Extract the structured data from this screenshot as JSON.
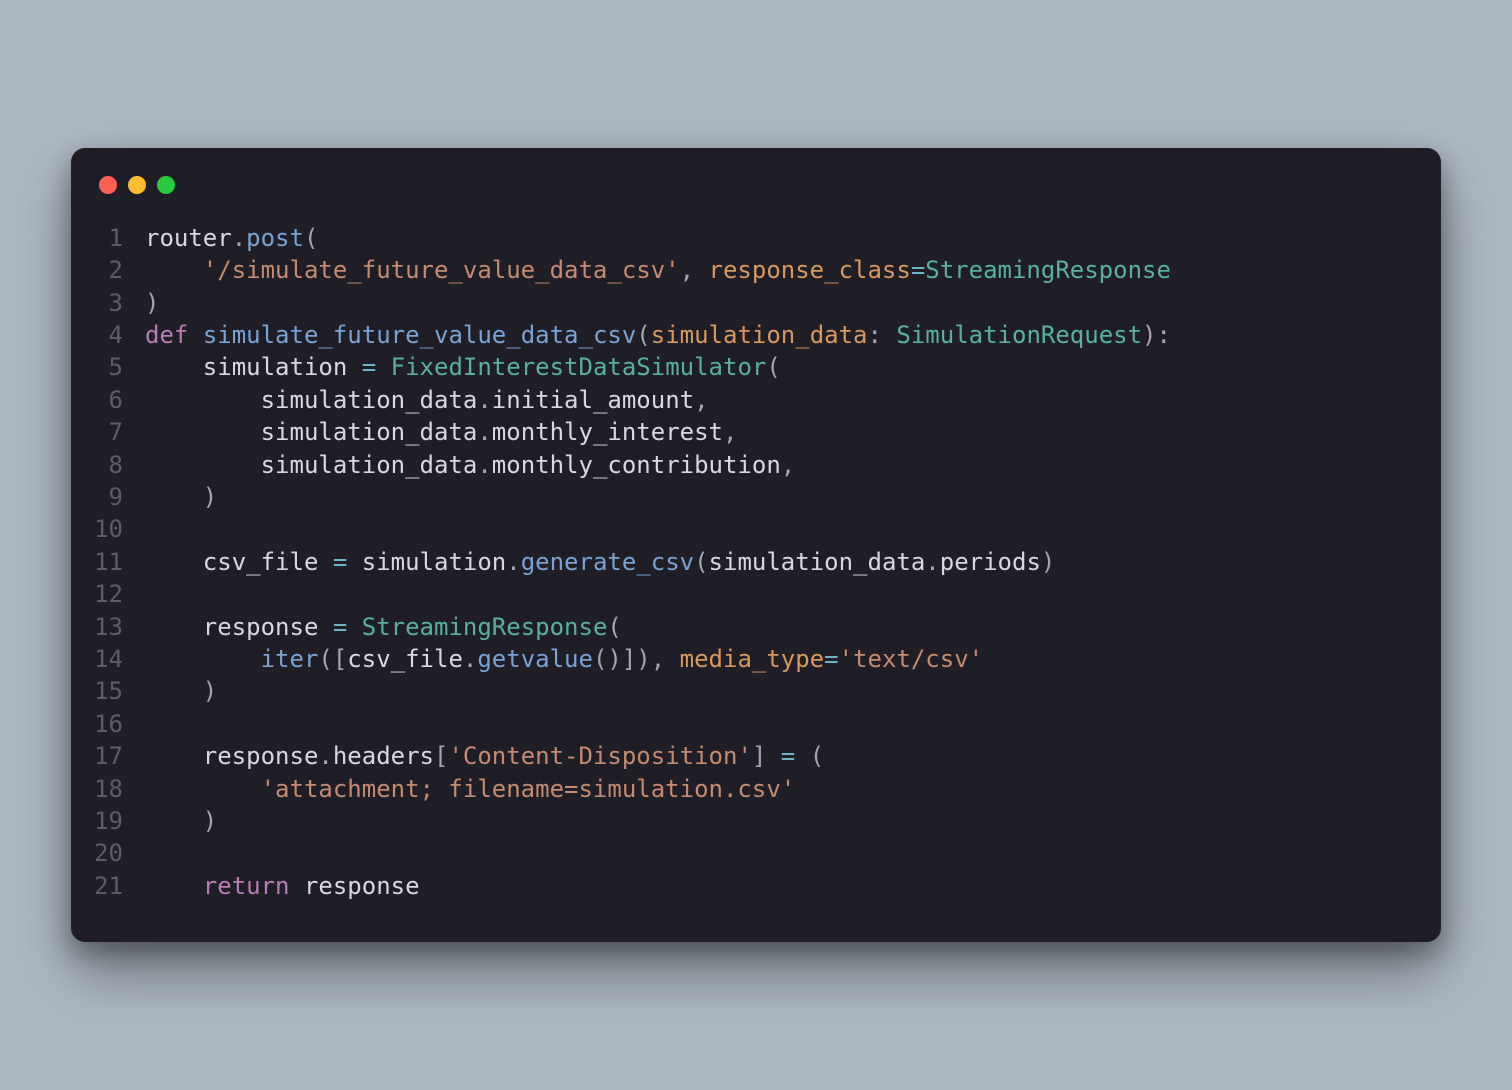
{
  "window": {
    "traffic_lights": [
      "red",
      "yellow",
      "green"
    ]
  },
  "code": {
    "line_numbers": [
      "1",
      "2",
      "3",
      "4",
      "5",
      "6",
      "7",
      "8",
      "9",
      "10",
      "11",
      "12",
      "13",
      "14",
      "15",
      "16",
      "17",
      "18",
      "19",
      "20",
      "21"
    ],
    "lines": [
      [
        {
          "cls": "t-ident",
          "text": "router"
        },
        {
          "cls": "t-punct",
          "text": "."
        },
        {
          "cls": "t-func",
          "text": "post"
        },
        {
          "cls": "t-punct",
          "text": "("
        }
      ],
      [
        {
          "cls": "t-default",
          "text": "    "
        },
        {
          "cls": "t-string",
          "text": "'/simulate_future_value_data_csv'"
        },
        {
          "cls": "t-punct",
          "text": ", "
        },
        {
          "cls": "t-param",
          "text": "response_class"
        },
        {
          "cls": "t-op",
          "text": "="
        },
        {
          "cls": "t-class",
          "text": "StreamingResponse"
        }
      ],
      [
        {
          "cls": "t-punct",
          "text": ")"
        }
      ],
      [
        {
          "cls": "t-keyword",
          "text": "def"
        },
        {
          "cls": "t-default",
          "text": " "
        },
        {
          "cls": "t-func",
          "text": "simulate_future_value_data_csv"
        },
        {
          "cls": "t-punct",
          "text": "("
        },
        {
          "cls": "t-param",
          "text": "simulation_data"
        },
        {
          "cls": "t-punct",
          "text": ": "
        },
        {
          "cls": "t-class",
          "text": "SimulationRequest"
        },
        {
          "cls": "t-punct",
          "text": "):"
        }
      ],
      [
        {
          "cls": "t-default",
          "text": "    "
        },
        {
          "cls": "t-ident",
          "text": "simulation"
        },
        {
          "cls": "t-default",
          "text": " "
        },
        {
          "cls": "t-op",
          "text": "="
        },
        {
          "cls": "t-default",
          "text": " "
        },
        {
          "cls": "t-class",
          "text": "FixedInterestDataSimulator"
        },
        {
          "cls": "t-punct",
          "text": "("
        }
      ],
      [
        {
          "cls": "t-default",
          "text": "        "
        },
        {
          "cls": "t-ident",
          "text": "simulation_data"
        },
        {
          "cls": "t-punct",
          "text": "."
        },
        {
          "cls": "t-attr",
          "text": "initial_amount"
        },
        {
          "cls": "t-punct",
          "text": ","
        }
      ],
      [
        {
          "cls": "t-default",
          "text": "        "
        },
        {
          "cls": "t-ident",
          "text": "simulation_data"
        },
        {
          "cls": "t-punct",
          "text": "."
        },
        {
          "cls": "t-attr",
          "text": "monthly_interest"
        },
        {
          "cls": "t-punct",
          "text": ","
        }
      ],
      [
        {
          "cls": "t-default",
          "text": "        "
        },
        {
          "cls": "t-ident",
          "text": "simulation_data"
        },
        {
          "cls": "t-punct",
          "text": "."
        },
        {
          "cls": "t-attr",
          "text": "monthly_contribution"
        },
        {
          "cls": "t-punct",
          "text": ","
        }
      ],
      [
        {
          "cls": "t-default",
          "text": "    "
        },
        {
          "cls": "t-punct",
          "text": ")"
        }
      ],
      [
        {
          "cls": "t-default",
          "text": ""
        }
      ],
      [
        {
          "cls": "t-default",
          "text": "    "
        },
        {
          "cls": "t-ident",
          "text": "csv_file"
        },
        {
          "cls": "t-default",
          "text": " "
        },
        {
          "cls": "t-op",
          "text": "="
        },
        {
          "cls": "t-default",
          "text": " "
        },
        {
          "cls": "t-ident",
          "text": "simulation"
        },
        {
          "cls": "t-punct",
          "text": "."
        },
        {
          "cls": "t-func",
          "text": "generate_csv"
        },
        {
          "cls": "t-punct",
          "text": "("
        },
        {
          "cls": "t-ident",
          "text": "simulation_data"
        },
        {
          "cls": "t-punct",
          "text": "."
        },
        {
          "cls": "t-attr",
          "text": "periods"
        },
        {
          "cls": "t-punct",
          "text": ")"
        }
      ],
      [
        {
          "cls": "t-default",
          "text": ""
        }
      ],
      [
        {
          "cls": "t-default",
          "text": "    "
        },
        {
          "cls": "t-ident",
          "text": "response"
        },
        {
          "cls": "t-default",
          "text": " "
        },
        {
          "cls": "t-op",
          "text": "="
        },
        {
          "cls": "t-default",
          "text": " "
        },
        {
          "cls": "t-class",
          "text": "StreamingResponse"
        },
        {
          "cls": "t-punct",
          "text": "("
        }
      ],
      [
        {
          "cls": "t-default",
          "text": "        "
        },
        {
          "cls": "t-func",
          "text": "iter"
        },
        {
          "cls": "t-punct",
          "text": "(["
        },
        {
          "cls": "t-ident",
          "text": "csv_file"
        },
        {
          "cls": "t-punct",
          "text": "."
        },
        {
          "cls": "t-func",
          "text": "getvalue"
        },
        {
          "cls": "t-punct",
          "text": "()]), "
        },
        {
          "cls": "t-param",
          "text": "media_type"
        },
        {
          "cls": "t-op",
          "text": "="
        },
        {
          "cls": "t-string",
          "text": "'text/csv'"
        }
      ],
      [
        {
          "cls": "t-default",
          "text": "    "
        },
        {
          "cls": "t-punct",
          "text": ")"
        }
      ],
      [
        {
          "cls": "t-default",
          "text": ""
        }
      ],
      [
        {
          "cls": "t-default",
          "text": "    "
        },
        {
          "cls": "t-ident",
          "text": "response"
        },
        {
          "cls": "t-punct",
          "text": "."
        },
        {
          "cls": "t-attr",
          "text": "headers"
        },
        {
          "cls": "t-punct",
          "text": "["
        },
        {
          "cls": "t-string",
          "text": "'Content-Disposition'"
        },
        {
          "cls": "t-punct",
          "text": "] "
        },
        {
          "cls": "t-op",
          "text": "="
        },
        {
          "cls": "t-punct",
          "text": " ("
        }
      ],
      [
        {
          "cls": "t-default",
          "text": "        "
        },
        {
          "cls": "t-string",
          "text": "'attachment; filename=simulation.csv'"
        }
      ],
      [
        {
          "cls": "t-default",
          "text": "    "
        },
        {
          "cls": "t-punct",
          "text": ")"
        }
      ],
      [
        {
          "cls": "t-default",
          "text": ""
        }
      ],
      [
        {
          "cls": "t-default",
          "text": "    "
        },
        {
          "cls": "t-keyword",
          "text": "return"
        },
        {
          "cls": "t-default",
          "text": " "
        },
        {
          "cls": "t-ident",
          "text": "response"
        }
      ]
    ]
  }
}
